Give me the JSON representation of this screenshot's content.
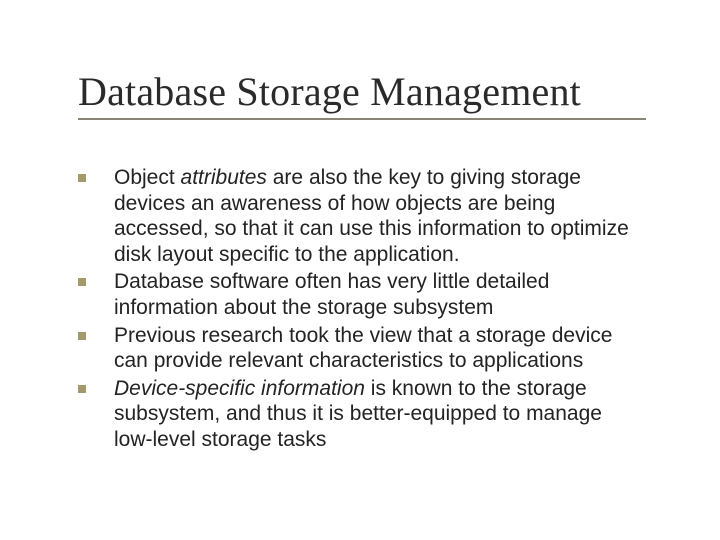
{
  "title": "Database Storage Management",
  "bullets": [
    {
      "pre": "Object ",
      "em": "attributes",
      "post": " are also the key to giving storage devices an awareness of how objects are being accessed, so that it can use this information to optimize disk layout specific to the application."
    },
    {
      "pre": "Database software often has very little detailed information about the storage subsystem",
      "em": "",
      "post": ""
    },
    {
      "pre": "Previous research took the view that a storage device can provide relevant characteristics to applications",
      "em": "",
      "post": ""
    },
    {
      "pre": "",
      "em": "Device-specific information",
      "post": " is known to the storage subsystem, and thus it is better-equipped to manage low-level storage tasks"
    }
  ]
}
